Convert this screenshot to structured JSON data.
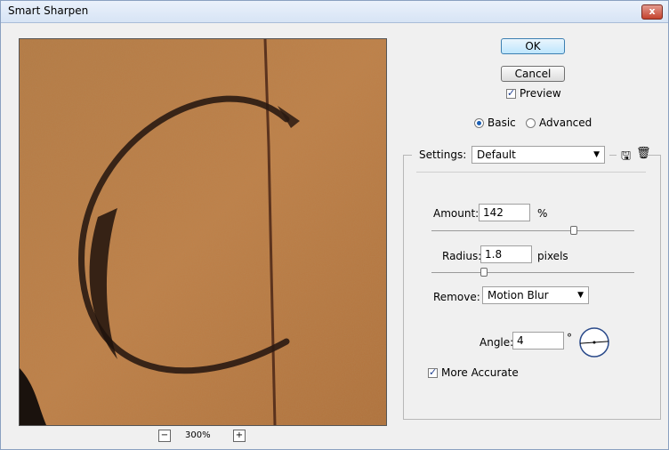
{
  "window": {
    "title": "Smart Sharpen",
    "close_glyph": "x"
  },
  "preview": {
    "zoom_label": "300%",
    "zoom_out_glyph": "−",
    "zoom_in_glyph": "+"
  },
  "buttons": {
    "ok": "OK",
    "cancel": "Cancel"
  },
  "preview_checkbox": {
    "label": "Preview",
    "checked": true
  },
  "mode": {
    "options": [
      "Basic",
      "Advanced"
    ],
    "selected": "Basic"
  },
  "settings": {
    "label": "Settings:",
    "value": "Default",
    "icons": [
      "save-settings-icon",
      "delete-settings-icon"
    ]
  },
  "amount": {
    "label": "Amount:",
    "value": "142",
    "unit": "%",
    "slider_fraction": 0.71
  },
  "radius": {
    "label": "Radius:",
    "value": "1.8",
    "unit": "pixels",
    "slider_fraction": 0.25
  },
  "remove": {
    "label": "Remove:",
    "value": "Motion Blur"
  },
  "angle": {
    "label": "Angle:",
    "value": "4",
    "unit": "°"
  },
  "more_accurate": {
    "label": "More Accurate",
    "checked": true
  },
  "colors": {
    "preview_base": "#b8773e",
    "stroke": "#2a1a12",
    "accent": "#1b5fb4"
  }
}
